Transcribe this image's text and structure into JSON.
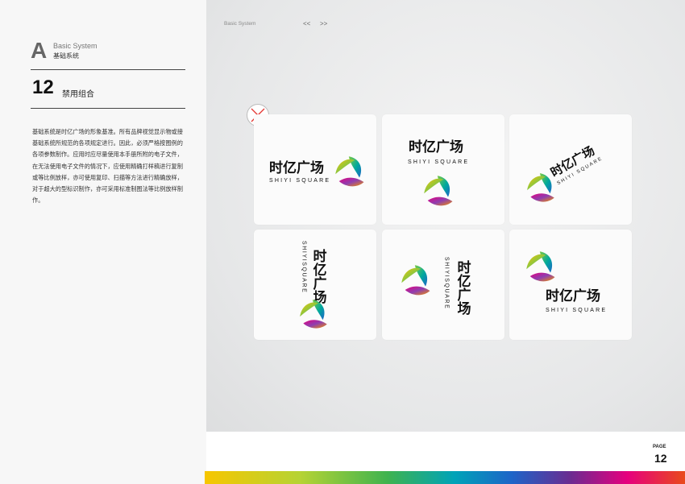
{
  "section": {
    "letter": "A",
    "title_en": "Basic System",
    "title_cn": "基础系统"
  },
  "page": {
    "number": "12",
    "title": "禁用组合",
    "label": "PAGE"
  },
  "body_text": "基础系统是时亿广场的形象基准。所有品牌视觉显示物或接基础系统所规范的各项规定进行。因此，必须严格按图例的各项参数制作。应用时应尽量使用本手册所附的电子文件，在无法使用电子文件的情况下，应使用精确打样稿进行复制或等比例放样，亦可使用复印、扫描等方法进行精确放样，对于超大的型标识制作，亦可采用标准制图法等比例放样制作。",
  "header": {
    "title": "Basic System",
    "prev": "<<",
    "next": ">>"
  },
  "logo": {
    "cn": "时亿广场",
    "en": "SHIYI SQUARE",
    "vertical_en": "SHIYISQUARE"
  },
  "colors": {
    "accent_red": "#e53935",
    "gradient": [
      "#f7c600",
      "#7ac943",
      "#00a99d",
      "#1e64c8",
      "#6a2c91",
      "#e6007e",
      "#e94b1b"
    ]
  }
}
